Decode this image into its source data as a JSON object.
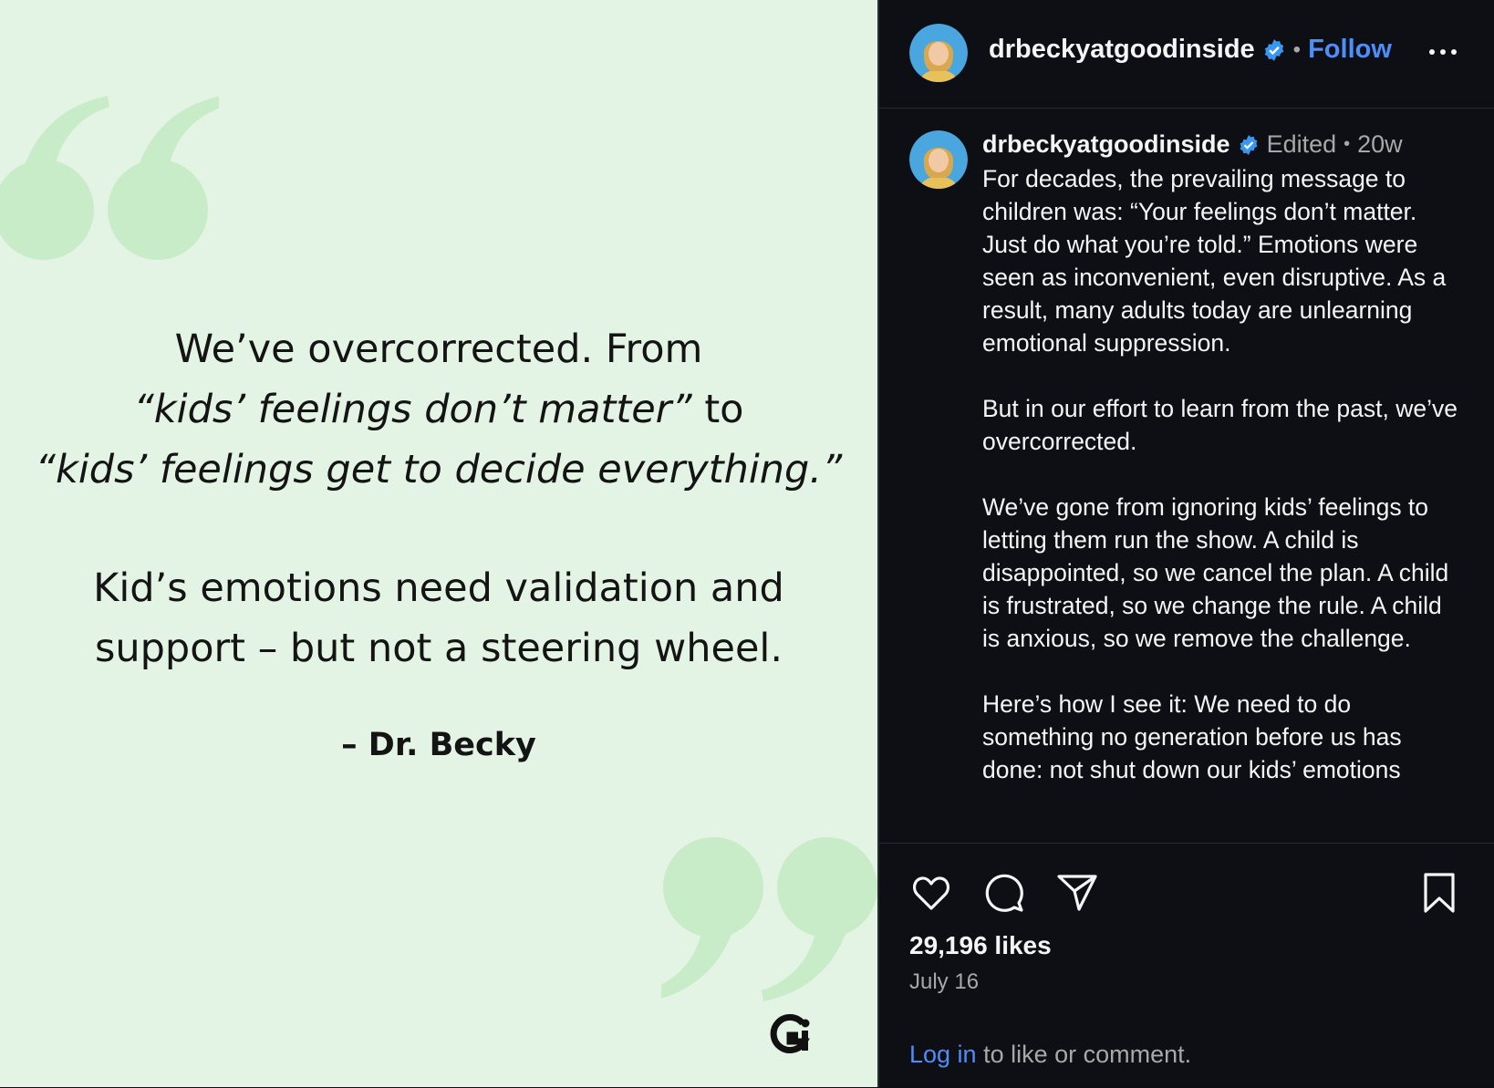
{
  "image": {
    "quote_line1": "We’ve overcorrected. From",
    "quote_line2": "“kids’ feelings don’t matter”",
    "quote_line2_tail": " to",
    "quote_line3": "“kids’ feelings get to decide everything.”",
    "body_line1": "Kid’s emotions need validation and",
    "body_line2": "support – but not a steering wheel.",
    "attribution": "– Dr. Becky",
    "logo_icon": "good-inside-logo-icon",
    "colors": {
      "background": "#e4f4e4",
      "quote_marks": "#c8ebc8"
    }
  },
  "post": {
    "header": {
      "username": "drbeckyatgoodinside",
      "separator": "•",
      "follow_label": "Follow"
    },
    "caption": {
      "username": "drbeckyatgoodinside",
      "edited_label": "Edited",
      "separator": "•",
      "age": "20w",
      "paragraphs": [
        "For decades, the prevailing message to children was: “Your feelings don’t matter. Just do what you’re told.” Emotions were seen as inconvenient, even disruptive. As a result, many adults today are unlearning emotional suppression.",
        "But in our effort to learn from the past, we’ve overcorrected.",
        "We’ve gone from ignoring kids’ feelings to letting them run the show. A child is disappointed, so we cancel the plan. A child is frustrated, so we change the rule. A child is anxious, so we remove the challenge.",
        "Here’s how I see it: We need to do something no generation before us has done: not shut down our kids’ emotions"
      ]
    },
    "likes": "29,196 likes",
    "date": "July 16",
    "login_link": "Log in",
    "login_tail": " to like or comment.",
    "colors": {
      "link": "#4f8df8",
      "verified": "#3897f0",
      "panel": "#0d0f14"
    }
  }
}
